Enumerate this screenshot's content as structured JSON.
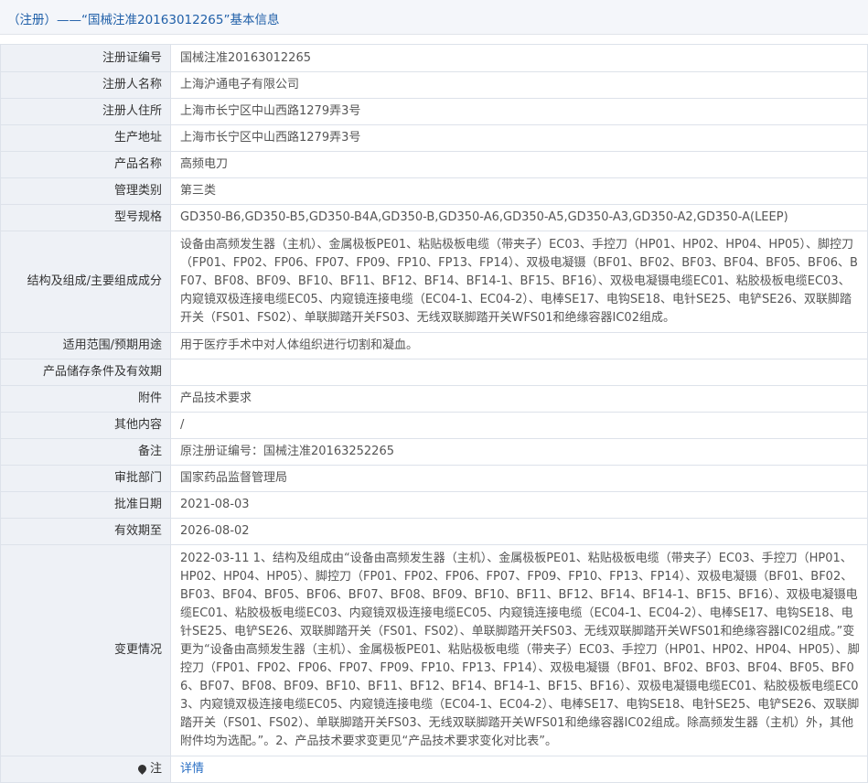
{
  "header": {
    "title": "（注册）——“国械注准20163012265”基本信息"
  },
  "rows": [
    {
      "label": "注册证编号",
      "value": "国械注准20163012265"
    },
    {
      "label": "注册人名称",
      "value": "上海沪通电子有限公司"
    },
    {
      "label": "注册人住所",
      "value": "上海市长宁区中山西路1279弄3号"
    },
    {
      "label": "生产地址",
      "value": "上海市长宁区中山西路1279弄3号"
    },
    {
      "label": "产品名称",
      "value": "高频电刀"
    },
    {
      "label": "管理类别",
      "value": "第三类"
    },
    {
      "label": "型号规格",
      "value": "GD350-B6,GD350-B5,GD350-B4A,GD350-B,GD350-A6,GD350-A5,GD350-A3,GD350-A2,GD350-A(LEEP)"
    },
    {
      "label": "结构及组成/主要组成成分",
      "value": "设备由高频发生器（主机）、金属极板PE01、粘贴极板电缆（带夹子）EC03、手控刀（HP01、HP02、HP04、HP05）、脚控刀（FP01、FP02、FP06、FP07、FP09、FP10、FP13、FP14）、双极电凝镊（BF01、BF02、BF03、BF04、BF05、BF06、BF07、BF08、BF09、BF10、BF11、BF12、BF14、BF14-1、BF15、BF16）、双极电凝镊电缆EC01、粘胶极板电缆EC03、内窥镜双极连接电缆EC05、内窥镜连接电缆（EC04-1、EC04-2）、电棒SE17、电钩SE18、电针SE25、电铲SE26、双联脚踏开关（FS01、FS02）、单联脚踏开关FS03、无线双联脚踏开关WFS01和绝缘容器IC02组成。"
    },
    {
      "label": "适用范围/预期用途",
      "value": "用于医疗手术中对人体组织进行切割和凝血。"
    },
    {
      "label": "产品储存条件及有效期",
      "value": ""
    },
    {
      "label": "附件",
      "value": "产品技术要求"
    },
    {
      "label": "其他内容",
      "value": "/"
    },
    {
      "label": "备注",
      "value": "原注册证编号：国械注准20163252265"
    },
    {
      "label": "审批部门",
      "value": "国家药品监督管理局"
    },
    {
      "label": "批准日期",
      "value": "2021-08-03"
    },
    {
      "label": "有效期至",
      "value": "2026-08-02"
    },
    {
      "label": "变更情况",
      "value": "2022-03-11 1、结构及组成由“设备由高频发生器（主机）、金属极板PE01、粘贴极板电缆（带夹子）EC03、手控刀（HP01、HP02、HP04、HP05）、脚控刀（FP01、FP02、FP06、FP07、FP09、FP10、FP13、FP14）、双极电凝镊（BF01、BF02、BF03、BF04、BF05、BF06、BF07、BF08、BF09、BF10、BF11、BF12、BF14、BF14-1、BF15、BF16）、双极电凝镊电缆EC01、粘胶极板电缆EC03、内窥镜双极连接电缆EC05、内窥镜连接电缆（EC04-1、EC04-2）、电棒SE17、电钩SE18、电针SE25、电铲SE26、双联脚踏开关（FS01、FS02）、单联脚踏开关FS03、无线双联脚踏开关WFS01和绝缘容器IC02组成。”变更为“设备由高频发生器（主机）、金属极板PE01、粘贴极板电缆（带夹子）EC03、手控刀（HP01、HP02、HP04、HP05）、脚控刀（FP01、FP02、FP06、FP07、FP09、FP10、FP13、FP14）、双极电凝镊（BF01、BF02、BF03、BF04、BF05、BF06、BF07、BF08、BF09、BF10、BF11、BF12、BF14、BF14-1、BF15、BF16）、双极电凝镊电缆EC01、粘胶极板电缆EC03、内窥镜双极连接电缆EC05、内窥镜连接电缆（EC04-1、EC04-2）、电棒SE17、电钩SE18、电针SE25、电铲SE26、双联脚踏开关（FS01、FS02）、单联脚踏开关FS03、无线双联脚踏开关WFS01和绝缘容器IC02组成。除高频发生器（主机）外，其他附件均为选配。”。2、产品技术要求变更见“产品技术要求变化对比表”。"
    }
  ],
  "note": {
    "label": "注",
    "link_text": "详情",
    "icon": "pin-icon"
  },
  "colors": {
    "header_text": "#1f5fa8",
    "label_bg": "#eef1f6",
    "border": "#dde2ea",
    "link": "#2a6fc4"
  }
}
